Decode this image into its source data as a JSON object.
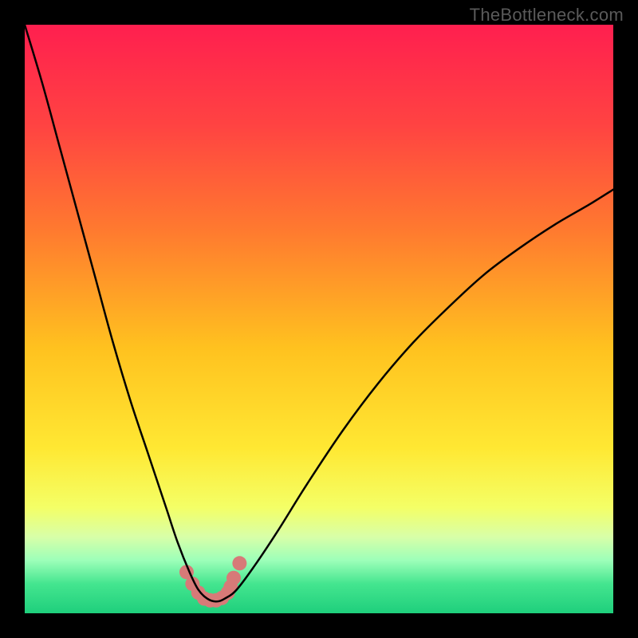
{
  "watermark": "TheBottleneck.com",
  "chart_data": {
    "type": "line",
    "title": "",
    "xlabel": "",
    "ylabel": "",
    "xlim": [
      0,
      100
    ],
    "ylim": [
      0,
      100
    ],
    "gradient_stops": [
      {
        "offset": 0.0,
        "color": "#ff1f4f"
      },
      {
        "offset": 0.17,
        "color": "#ff4342"
      },
      {
        "offset": 0.35,
        "color": "#ff7a2f"
      },
      {
        "offset": 0.55,
        "color": "#ffc21f"
      },
      {
        "offset": 0.72,
        "color": "#ffe833"
      },
      {
        "offset": 0.82,
        "color": "#f4ff66"
      },
      {
        "offset": 0.87,
        "color": "#d8ffa8"
      },
      {
        "offset": 0.91,
        "color": "#9dffb9"
      },
      {
        "offset": 0.95,
        "color": "#44e58f"
      },
      {
        "offset": 1.0,
        "color": "#1fcf7c"
      }
    ],
    "series": [
      {
        "name": "bottleneck-curve",
        "color": "#000000",
        "width": 2.5,
        "x": [
          0,
          3,
          6,
          9,
          12,
          15,
          18,
          21,
          24,
          26,
          28,
          29.5,
          31,
          32.5,
          34,
          36,
          39,
          43,
          48,
          54,
          60,
          66,
          72,
          78,
          84,
          90,
          96,
          100
        ],
        "y": [
          100,
          90,
          79,
          68,
          57,
          46,
          36,
          27,
          18,
          12,
          7,
          4,
          2.5,
          2,
          2.5,
          4,
          8,
          14,
          22,
          31,
          39,
          46,
          52,
          57.5,
          62,
          66,
          69.5,
          72
        ]
      },
      {
        "name": "highlight-dots",
        "color": "#d77a78",
        "shape": "blob",
        "x": [
          27.5,
          28.5,
          29.5,
          30.5,
          31.5,
          32.5,
          33.5,
          34.5,
          35.0,
          35.5,
          36.5
        ],
        "y": [
          7.0,
          5.0,
          3.5,
          2.5,
          2.2,
          2.2,
          2.6,
          3.5,
          4.5,
          6.0,
          8.5
        ]
      }
    ],
    "annotations": []
  }
}
